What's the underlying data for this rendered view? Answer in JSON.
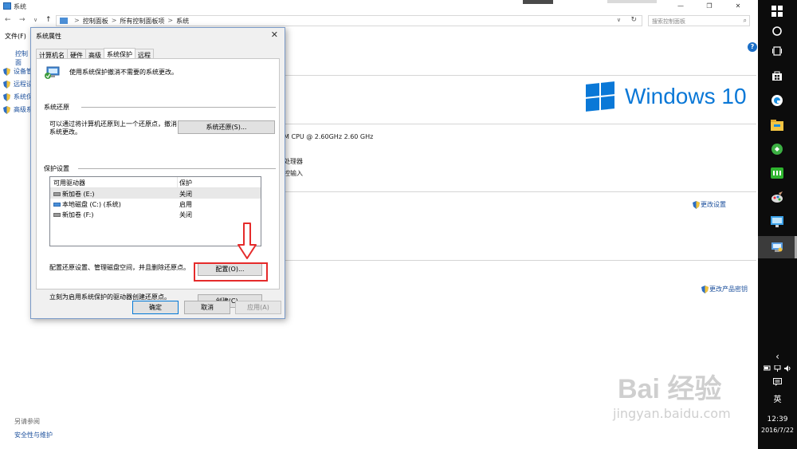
{
  "window": {
    "title": "系统",
    "buttons": [
      "—",
      "❐",
      "✕"
    ]
  },
  "address": {
    "back": "←",
    "forward": "→",
    "recent": "∨",
    "up": "↑",
    "crumbs": [
      "控制面板",
      "所有控制面板项",
      "系统"
    ],
    "crumb_separator": ">",
    "dropdown": "∨",
    "refresh": "↻",
    "search_placeholder": "搜索控制面板",
    "search_icon": "⌕"
  },
  "menubar": {
    "file": "文件(F)"
  },
  "help": "?",
  "left_pane": {
    "home": "控制面",
    "items": [
      "设备管",
      "远程设",
      "系统保",
      "高级系"
    ],
    "see_also": "另请参阅",
    "security_link": "安全性与维护"
  },
  "main": {
    "logo_text": "Windows 10",
    "cpu": "M CPU @ 2.60GHz   2.60 GHz",
    "processor": "处理器",
    "pen": "控输入",
    "change_settings": "更改设置",
    "change_key": "更改产品密钥"
  },
  "dialog": {
    "title": "系统属性",
    "close": "✕",
    "tabs": [
      "计算机名",
      "硬件",
      "高级",
      "系统保护",
      "远程"
    ],
    "active_tab": 3,
    "description": "使用系统保护撤消不需要的系统更改。",
    "restore_section": "系统还原",
    "restore_text": "可以通过将计算机还原到上一个还原点，撤消系统更改。",
    "restore_button": "系统还原(S)...",
    "protection_section": "保护设置",
    "drive_header": {
      "name": "可用驱动器",
      "protection": "保护"
    },
    "drives": [
      {
        "name": "新加卷 (E:)",
        "protection": "关闭",
        "win": false
      },
      {
        "name": "本地磁盘 (C:) (系统)",
        "protection": "启用",
        "win": true
      },
      {
        "name": "新加卷 (F:)",
        "protection": "关闭",
        "win": false
      }
    ],
    "configure_text": "配置还原设置、管理磁盘空间，并且删除还原点。",
    "configure_button": "配置(O)...",
    "create_text": "立刻为启用系统保护的驱动器创建还原点。",
    "create_button": "创建(C)...",
    "ok_button": "确定",
    "cancel_button": "取消",
    "apply_button": "应用(A)"
  },
  "taskbar": {
    "icons": [
      "start-icon",
      "cortana-icon",
      "task-view-icon",
      "store-icon",
      "browser-icon",
      "file-explorer-icon",
      "green-app-icon",
      "iqiyi-icon",
      "paint-icon",
      "remote-desktop-icon",
      "control-panel-icon"
    ],
    "chevron": "‹",
    "ime": "英",
    "time": "12:39",
    "date": "2016/7/22"
  },
  "watermark": {
    "brand": "Bai 经验",
    "url": "jingyan.baidu.com"
  }
}
